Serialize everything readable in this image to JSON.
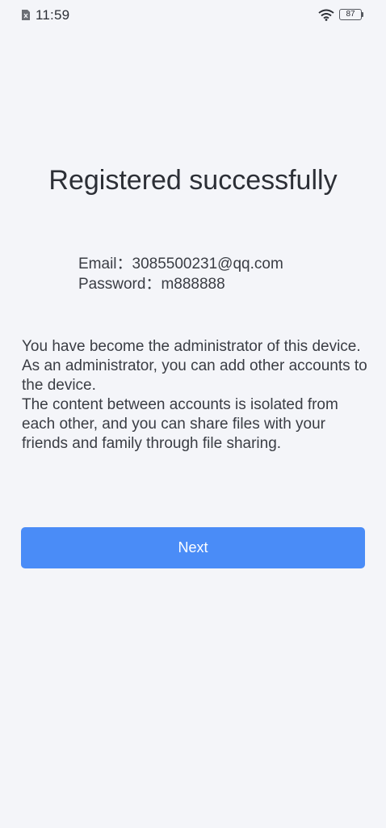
{
  "status_bar": {
    "time": "11:59",
    "battery_percent": "87",
    "icons": [
      "sim-icon",
      "wifi-icon",
      "battery-icon"
    ]
  },
  "main": {
    "title": "Registered successfully",
    "email_label": "Email：",
    "email_value": "3085500231@qq.com",
    "password_label": "Password：",
    "password_value": "m888888",
    "description_1": "You have become the administrator of this device. As an administrator, you can add other accounts to the device.",
    "description_2": "The content between accounts is isolated from each other, and you can share files with your friends and family through file sharing.",
    "next_label": "Next"
  },
  "colors": {
    "background": "#f4f5f9",
    "accent": "#4a8cf7",
    "text": "#2c2f36"
  }
}
